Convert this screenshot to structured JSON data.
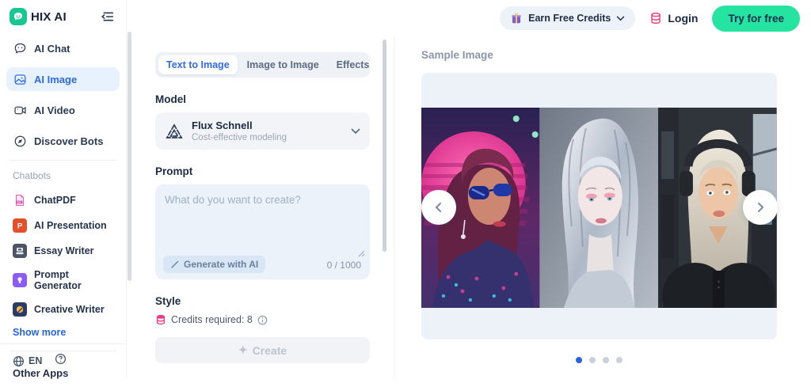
{
  "colors": {
    "accent_blue": "#2f6bf0",
    "active_nav_bg": "#e8f1fe",
    "cta_green": "#25e3a0",
    "cta_text": "#0d2c4e",
    "pink_credits": "#ee3b82",
    "card_bg": "#edf2f9",
    "dot_active": "#2563eb"
  },
  "sidebar": {
    "brand": "HIX AI",
    "nav": [
      {
        "label": "AI Chat",
        "icon": "chat-icon",
        "active": false
      },
      {
        "label": "AI Image",
        "icon": "image-icon",
        "active": true
      },
      {
        "label": "AI Video",
        "icon": "video-icon",
        "active": false
      },
      {
        "label": "Discover Bots",
        "icon": "compass-icon",
        "active": false
      }
    ],
    "chatbots": {
      "heading": "Chatbots",
      "items": [
        {
          "label": "ChatPDF",
          "icon": "pdf-file-icon",
          "color": "#f6e3f2"
        },
        {
          "label": "AI Presentation",
          "icon": "presentation-icon",
          "color": "#e2502c"
        },
        {
          "label": "Essay Writer",
          "icon": "typewriter-icon",
          "color": "#4b5563"
        },
        {
          "label": "Prompt Generator",
          "icon": "lightbulb-icon",
          "color": "#8b5cf6"
        },
        {
          "label": "Creative Writer",
          "icon": "pencil-icon",
          "color": "#2b3a67"
        }
      ],
      "show_more": "Show more"
    },
    "other_apps": "Other Apps",
    "footer": {
      "language": "EN"
    }
  },
  "header": {
    "earn_credits": "Earn Free Credits",
    "login": "Login",
    "try_free": "Try for free"
  },
  "generator": {
    "tabs": [
      {
        "label": "Text to Image",
        "active": true
      },
      {
        "label": "Image to Image",
        "active": false
      },
      {
        "label": "Effects",
        "active": false
      }
    ],
    "model": {
      "heading": "Model",
      "name": "Flux Schnell",
      "description": "Cost-effective modeling"
    },
    "prompt": {
      "heading": "Prompt",
      "placeholder": "What do you want to create?",
      "value": "",
      "generate_button": "Generate with AI",
      "counter": "0 / 1000"
    },
    "style_heading": "Style",
    "credits_label": "Credits required: 8",
    "create_button": "Create",
    "create_sparkle": "✦"
  },
  "sample": {
    "heading": "Sample Image",
    "images": [
      {
        "name": "synthwave-woman-with-sunglasses"
      },
      {
        "name": "chrome-silver-haired-woman"
      },
      {
        "name": "sci-fi-pilot-with-headphones"
      }
    ],
    "dots": {
      "count": 4,
      "active_index": 0
    }
  }
}
